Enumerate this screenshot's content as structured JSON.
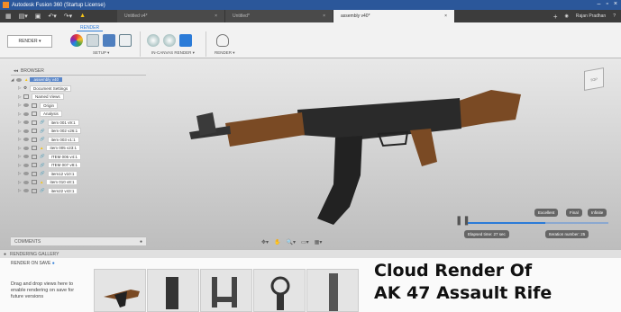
{
  "window": {
    "title": "Autodesk Fusion 360 (Startup License)"
  },
  "tabs": [
    {
      "label": "Untitled v4*"
    },
    {
      "label": "Untitled*"
    },
    {
      "label": "assembly v40*"
    }
  ],
  "user": {
    "name": "Rajan Pradhan"
  },
  "toolbar": {
    "workspace": "RENDER ▾",
    "tab_label": "RENDER",
    "groups": {
      "setup": "SETUP ▾",
      "in_canvas": "IN-CANVAS RENDER ▾",
      "render": "RENDER ▾"
    }
  },
  "browser": {
    "title": "BROWSER",
    "root": "assembly v40",
    "items": [
      {
        "label": "Document Settings"
      },
      {
        "label": "Named Views"
      },
      {
        "label": "Origin"
      },
      {
        "label": "Analysis"
      },
      {
        "label": "item 001 v9:1"
      },
      {
        "label": "item 002 v26:1"
      },
      {
        "label": "item 003 v1:1"
      },
      {
        "label": "item 005 v23:1"
      },
      {
        "label": "ITEM 006 v4:1"
      },
      {
        "label": "ITEM 007 v8:1"
      },
      {
        "label": "item12 v10:1"
      },
      {
        "label": "item 010 v8:1"
      },
      {
        "label": "item22 v43:1"
      }
    ]
  },
  "comments": {
    "label": "COMMENTS"
  },
  "render_controls": {
    "quality": [
      "Excellent",
      "Final",
      "Infinite"
    ],
    "progress": 0.55,
    "elapsed": "Elapsed time: 27 sec",
    "iteration": "Iteration number: 25"
  },
  "gallery": {
    "title": "RENDERING GALLERY",
    "render_on_save": "RENDER ON SAVE",
    "hint": "Drag and drop views here to enable rendering on save for future versions"
  },
  "overlay": {
    "line1": "Cloud Render Of",
    "line2": "AK 47 Assault Rife"
  },
  "colors": {
    "accent": "#2b7bd8",
    "titlebar": "#2b579a",
    "wood": "#7a4a24",
    "metal": "#2a2a2a"
  }
}
